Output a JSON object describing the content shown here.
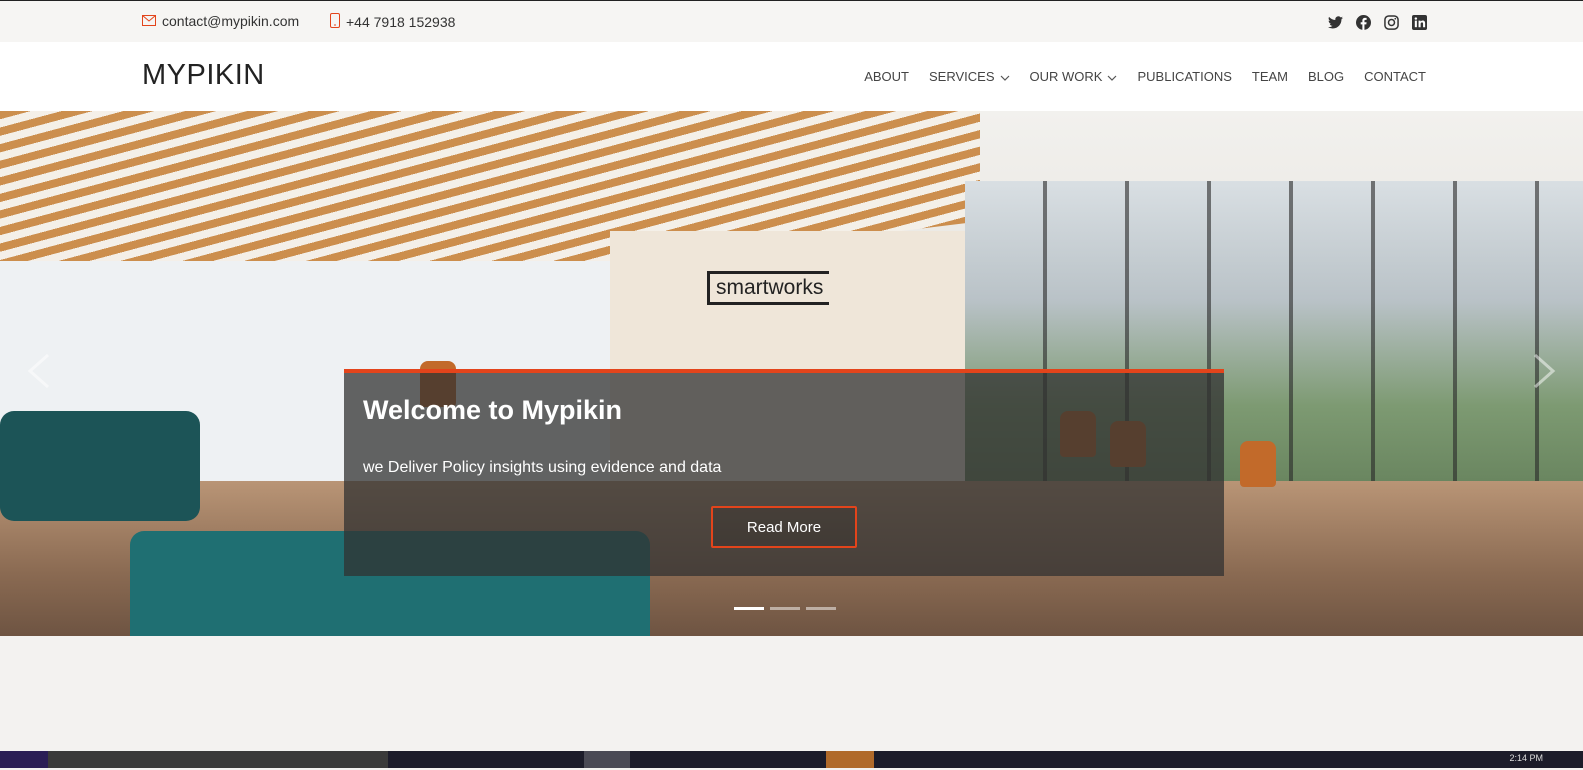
{
  "topbar": {
    "email": "contact@mypikin.com",
    "phone": "+44 7918 152938",
    "socials": [
      "twitter-icon",
      "facebook-icon",
      "instagram-icon",
      "linkedin-icon"
    ]
  },
  "nav": {
    "logo": "MYPIKIN",
    "items": [
      {
        "label": "ABOUT"
      },
      {
        "label": "SERVICES"
      },
      {
        "label": "OUR WORK"
      },
      {
        "label": "PUBLICATIONS"
      },
      {
        "label": "TEAM"
      },
      {
        "label": "BLOG"
      },
      {
        "label": "CONTACT"
      }
    ]
  },
  "hero": {
    "sign_text": "smartworks",
    "title": "Welcome to Mypikin",
    "subtitle": "we Deliver Policy insights using evidence and data",
    "button": "Read More",
    "slides": 3,
    "active_slide": 1
  },
  "taskbar": {
    "clock": "2:14 PM"
  },
  "colors": {
    "accent": "#e3441b",
    "topbar_bg": "#f6f5f3",
    "caption_bg": "rgba(50,50,50,0.75)"
  }
}
